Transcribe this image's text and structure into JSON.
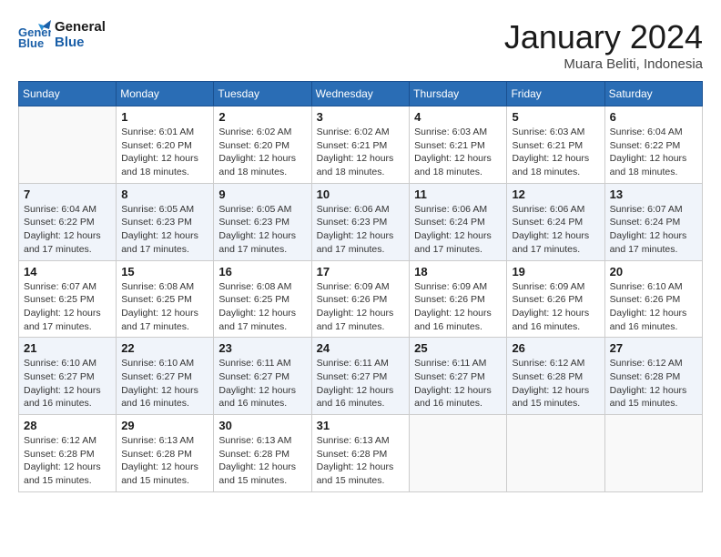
{
  "header": {
    "logo_line1": "General",
    "logo_line2": "Blue",
    "month_title": "January 2024",
    "location": "Muara Beliti, Indonesia"
  },
  "weekdays": [
    "Sunday",
    "Monday",
    "Tuesday",
    "Wednesday",
    "Thursday",
    "Friday",
    "Saturday"
  ],
  "weeks": [
    [
      {
        "day": "",
        "empty": true
      },
      {
        "day": "1",
        "sunrise": "6:01 AM",
        "sunset": "6:20 PM",
        "daylight": "12 hours and 18 minutes."
      },
      {
        "day": "2",
        "sunrise": "6:02 AM",
        "sunset": "6:20 PM",
        "daylight": "12 hours and 18 minutes."
      },
      {
        "day": "3",
        "sunrise": "6:02 AM",
        "sunset": "6:21 PM",
        "daylight": "12 hours and 18 minutes."
      },
      {
        "day": "4",
        "sunrise": "6:03 AM",
        "sunset": "6:21 PM",
        "daylight": "12 hours and 18 minutes."
      },
      {
        "day": "5",
        "sunrise": "6:03 AM",
        "sunset": "6:21 PM",
        "daylight": "12 hours and 18 minutes."
      },
      {
        "day": "6",
        "sunrise": "6:04 AM",
        "sunset": "6:22 PM",
        "daylight": "12 hours and 18 minutes."
      }
    ],
    [
      {
        "day": "7",
        "sunrise": "6:04 AM",
        "sunset": "6:22 PM",
        "daylight": "12 hours and 17 minutes."
      },
      {
        "day": "8",
        "sunrise": "6:05 AM",
        "sunset": "6:23 PM",
        "daylight": "12 hours and 17 minutes."
      },
      {
        "day": "9",
        "sunrise": "6:05 AM",
        "sunset": "6:23 PM",
        "daylight": "12 hours and 17 minutes."
      },
      {
        "day": "10",
        "sunrise": "6:06 AM",
        "sunset": "6:23 PM",
        "daylight": "12 hours and 17 minutes."
      },
      {
        "day": "11",
        "sunrise": "6:06 AM",
        "sunset": "6:24 PM",
        "daylight": "12 hours and 17 minutes."
      },
      {
        "day": "12",
        "sunrise": "6:06 AM",
        "sunset": "6:24 PM",
        "daylight": "12 hours and 17 minutes."
      },
      {
        "day": "13",
        "sunrise": "6:07 AM",
        "sunset": "6:24 PM",
        "daylight": "12 hours and 17 minutes."
      }
    ],
    [
      {
        "day": "14",
        "sunrise": "6:07 AM",
        "sunset": "6:25 PM",
        "daylight": "12 hours and 17 minutes."
      },
      {
        "day": "15",
        "sunrise": "6:08 AM",
        "sunset": "6:25 PM",
        "daylight": "12 hours and 17 minutes."
      },
      {
        "day": "16",
        "sunrise": "6:08 AM",
        "sunset": "6:25 PM",
        "daylight": "12 hours and 17 minutes."
      },
      {
        "day": "17",
        "sunrise": "6:09 AM",
        "sunset": "6:26 PM",
        "daylight": "12 hours and 17 minutes."
      },
      {
        "day": "18",
        "sunrise": "6:09 AM",
        "sunset": "6:26 PM",
        "daylight": "12 hours and 16 minutes."
      },
      {
        "day": "19",
        "sunrise": "6:09 AM",
        "sunset": "6:26 PM",
        "daylight": "12 hours and 16 minutes."
      },
      {
        "day": "20",
        "sunrise": "6:10 AM",
        "sunset": "6:26 PM",
        "daylight": "12 hours and 16 minutes."
      }
    ],
    [
      {
        "day": "21",
        "sunrise": "6:10 AM",
        "sunset": "6:27 PM",
        "daylight": "12 hours and 16 minutes."
      },
      {
        "day": "22",
        "sunrise": "6:10 AM",
        "sunset": "6:27 PM",
        "daylight": "12 hours and 16 minutes."
      },
      {
        "day": "23",
        "sunrise": "6:11 AM",
        "sunset": "6:27 PM",
        "daylight": "12 hours and 16 minutes."
      },
      {
        "day": "24",
        "sunrise": "6:11 AM",
        "sunset": "6:27 PM",
        "daylight": "12 hours and 16 minutes."
      },
      {
        "day": "25",
        "sunrise": "6:11 AM",
        "sunset": "6:27 PM",
        "daylight": "12 hours and 16 minutes."
      },
      {
        "day": "26",
        "sunrise": "6:12 AM",
        "sunset": "6:28 PM",
        "daylight": "12 hours and 15 minutes."
      },
      {
        "day": "27",
        "sunrise": "6:12 AM",
        "sunset": "6:28 PM",
        "daylight": "12 hours and 15 minutes."
      }
    ],
    [
      {
        "day": "28",
        "sunrise": "6:12 AM",
        "sunset": "6:28 PM",
        "daylight": "12 hours and 15 minutes."
      },
      {
        "day": "29",
        "sunrise": "6:13 AM",
        "sunset": "6:28 PM",
        "daylight": "12 hours and 15 minutes."
      },
      {
        "day": "30",
        "sunrise": "6:13 AM",
        "sunset": "6:28 PM",
        "daylight": "12 hours and 15 minutes."
      },
      {
        "day": "31",
        "sunrise": "6:13 AM",
        "sunset": "6:28 PM",
        "daylight": "12 hours and 15 minutes."
      },
      {
        "day": "",
        "empty": true
      },
      {
        "day": "",
        "empty": true
      },
      {
        "day": "",
        "empty": true
      }
    ]
  ]
}
